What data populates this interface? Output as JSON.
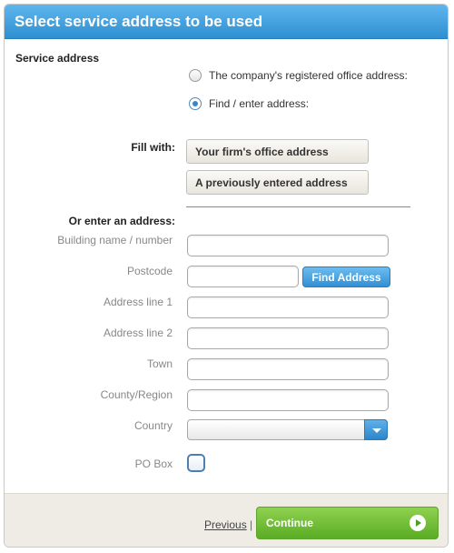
{
  "header": {
    "title": "Select service address to be used"
  },
  "section": {
    "title": "Service address"
  },
  "radios": [
    {
      "label": "The company's registered office address:",
      "checked": false
    },
    {
      "label": "Find / enter address:",
      "checked": true
    }
  ],
  "fill_with": {
    "label": "Fill with:",
    "buttons": [
      "Your firm's office address",
      "A previously entered address"
    ]
  },
  "enter_address": {
    "label": "Or enter an address:"
  },
  "fields": {
    "building": {
      "label": "Building name / number",
      "value": ""
    },
    "postcode": {
      "label": "Postcode",
      "value": ""
    },
    "address1": {
      "label": "Address line 1",
      "value": ""
    },
    "address2": {
      "label": "Address line 2",
      "value": ""
    },
    "town": {
      "label": "Town",
      "value": ""
    },
    "county": {
      "label": "County/Region",
      "value": ""
    },
    "country": {
      "label": "Country",
      "selected": ""
    },
    "pobox": {
      "label": "PO Box",
      "checked": false
    }
  },
  "find_address_button": "Find Address",
  "footer": {
    "previous": "Previous",
    "separator": "|",
    "continue": "Continue"
  },
  "colors": {
    "header_blue": "#3b9ae0",
    "continue_green": "#6cbd35",
    "footer_bg": "#eeece4"
  }
}
